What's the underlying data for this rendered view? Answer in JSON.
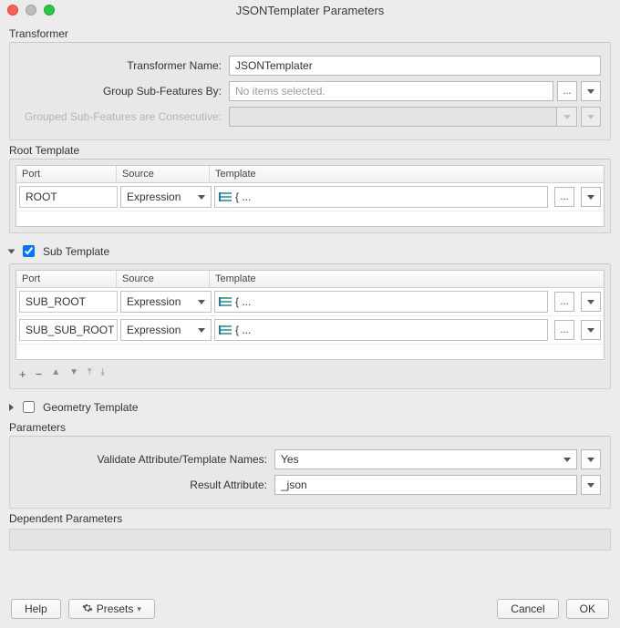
{
  "window": {
    "title": "JSONTemplater Parameters"
  },
  "transformer": {
    "section_label": "Transformer",
    "name_label": "Transformer Name:",
    "name_value": "JSONTemplater",
    "group_by_label": "Group Sub-Features By:",
    "group_by_placeholder": "No items selected.",
    "grouped_consecutive_label": "Grouped Sub-Features are Consecutive:"
  },
  "root_template": {
    "section_label": "Root Template",
    "headers": {
      "port": "Port",
      "source": "Source",
      "template": "Template"
    },
    "rows": [
      {
        "port": "ROOT",
        "source": "Expression",
        "template": "{ ..."
      }
    ]
  },
  "sub_template": {
    "section_label": "Sub Template",
    "enabled": true,
    "headers": {
      "port": "Port",
      "source": "Source",
      "template": "Template"
    },
    "rows": [
      {
        "port": "SUB_ROOT",
        "source": "Expression",
        "template": "{ ..."
      },
      {
        "port": "SUB_SUB_ROOT",
        "source": "Expression",
        "template": "{ ..."
      }
    ],
    "toolbar": {
      "add": "+",
      "remove": "−"
    }
  },
  "geometry_template": {
    "section_label": "Geometry Template",
    "enabled": false
  },
  "parameters": {
    "section_label": "Parameters",
    "validate_label": "Validate Attribute/Template Names:",
    "validate_value": "Yes",
    "result_attr_label": "Result Attribute:",
    "result_attr_value": "_json"
  },
  "dependent": {
    "section_label": "Dependent Parameters"
  },
  "footer": {
    "help": "Help",
    "presets": "Presets",
    "cancel": "Cancel",
    "ok": "OK"
  },
  "ellipsis": "..."
}
